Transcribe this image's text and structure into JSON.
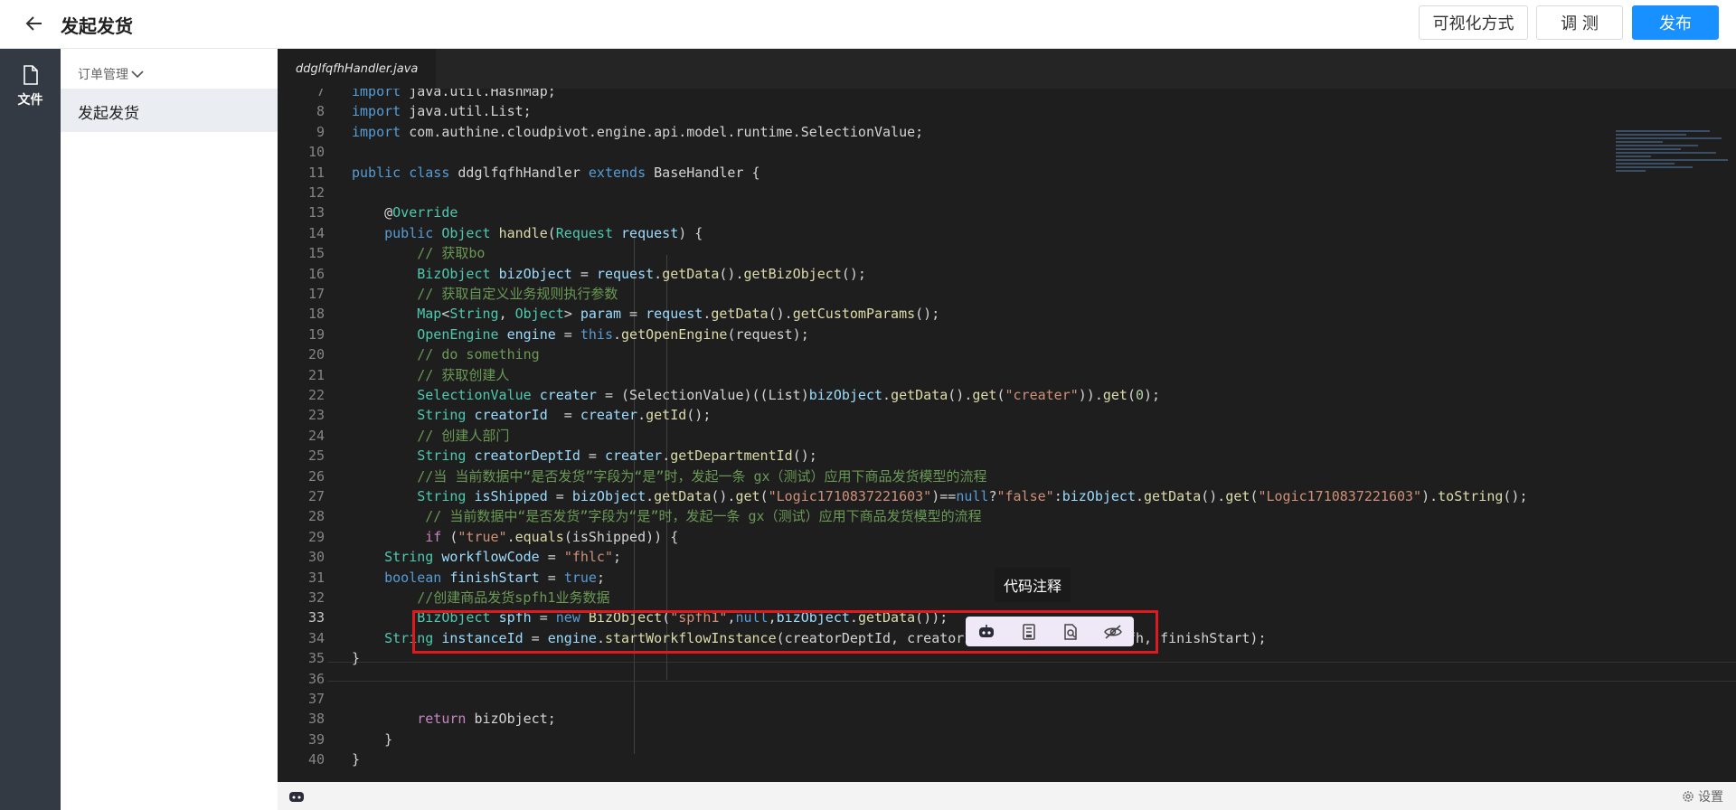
{
  "header": {
    "title": "发起发货",
    "buttons": {
      "visual": "可视化方式",
      "debug": "调 测",
      "publish": "发布"
    }
  },
  "rail": {
    "file_label": "文件"
  },
  "nav": {
    "group": "订单管理",
    "item": "发起发货"
  },
  "editor": {
    "tab": "ddglfqfhHandler.java",
    "tooltip": "代码注释",
    "lines": [
      {
        "n": "7",
        "html": "<span class=\"k\">import</span> java.util.HashMap;"
      },
      {
        "n": "8",
        "html": "<span class=\"k\">import</span> java.util.List;"
      },
      {
        "n": "9",
        "html": "<span class=\"k\">import</span> com.authine.cloudpivot.engine.api.model.runtime.SelectionValue;"
      },
      {
        "n": "10",
        "html": ""
      },
      {
        "n": "11",
        "html": "<span class=\"k\">public class</span> ddglfqfhHandler <span class=\"k\">extends</span> BaseHandler {"
      },
      {
        "n": "12",
        "html": ""
      },
      {
        "n": "13",
        "html": "    @<span class=\"t\">Override</span>"
      },
      {
        "n": "14",
        "html": "    <span class=\"k\">public</span> <span class=\"t\">Object</span> <span class=\"f\">handle</span>(<span class=\"t\">Request</span> <span class=\"v\">request</span>) {"
      },
      {
        "n": "15",
        "html": "        <span class=\"c\">// 获取bo</span>"
      },
      {
        "n": "16",
        "html": "        <span class=\"t\">BizObject</span> <span class=\"v\">bizObject</span> = <span class=\"v\">request</span>.<span class=\"f\">getData</span>().<span class=\"f\">getBizObject</span>();"
      },
      {
        "n": "17",
        "html": "        <span class=\"c\">// 获取自定义业务规则执行参数</span>"
      },
      {
        "n": "18",
        "html": "        <span class=\"t\">Map</span>&lt;<span class=\"t\">String</span>, <span class=\"t\">Object</span>&gt; <span class=\"v\">param</span> = <span class=\"v\">request</span>.<span class=\"f\">getData</span>().<span class=\"f\">getCustomParams</span>();"
      },
      {
        "n": "19",
        "html": "        <span class=\"t\">OpenEngine</span> <span class=\"v\">engine</span> = <span class=\"k\">this</span>.<span class=\"f\">getOpenEngine</span>(request);"
      },
      {
        "n": "20",
        "html": "        <span class=\"c\">// do something</span>"
      },
      {
        "n": "21",
        "html": "        <span class=\"c\">// 获取创建人</span>"
      },
      {
        "n": "22",
        "html": "        <span class=\"t\">SelectionValue</span> <span class=\"v\">creater</span> = (SelectionValue)((List)<span class=\"v\">bizObject</span>.<span class=\"f\">getData</span>().<span class=\"f\">get</span>(<span class=\"s\">\"creater\"</span>)).<span class=\"f\">get</span>(<span class=\"n\">0</span>);"
      },
      {
        "n": "23",
        "html": "        <span class=\"t\">String</span> <span class=\"v\">creatorId</span>  = <span class=\"v\">creater</span>.<span class=\"f\">getId</span>();"
      },
      {
        "n": "24",
        "html": "        <span class=\"c\">// 创建人部门</span>"
      },
      {
        "n": "25",
        "html": "        <span class=\"t\">String</span> <span class=\"v\">creatorDeptId</span> = <span class=\"v\">creater</span>.<span class=\"f\">getDepartmentId</span>();"
      },
      {
        "n": "26",
        "html": "        <span class=\"c\">//当 当前数据中“是否发货”字段为“是”时，发起一条 gx（测试）应用下商品发货模型的流程</span>"
      },
      {
        "n": "27",
        "html": "        <span class=\"t\">String</span> <span class=\"v\">isShipped</span> = <span class=\"v\">bizObject</span>.<span class=\"f\">getData</span>().<span class=\"f\">get</span>(<span class=\"s\">\"Logic1710837221603\"</span>)==<span class=\"k\">null</span>?<span class=\"s\">\"false\"</span>:<span class=\"v\">bizObject</span>.<span class=\"f\">getData</span>().<span class=\"f\">get</span>(<span class=\"s\">\"Logic1710837221603\"</span>).<span class=\"f\">toString</span>();"
      },
      {
        "n": "28",
        "html": "         <span class=\"c\">// 当前数据中“是否发货”字段为“是”时，发起一条 gx（测试）应用下商品发货模型的流程</span>"
      },
      {
        "n": "29",
        "html": "         <span class=\"p\">if</span> (<span class=\"s\">\"true\"</span>.<span class=\"f\">equals</span>(isShipped)) {"
      },
      {
        "n": "30",
        "html": "    <span class=\"t\">String</span> <span class=\"v\">workflowCode</span> = <span class=\"s\">\"fhlc\"</span>;"
      },
      {
        "n": "31",
        "html": "    <span class=\"k\">boolean</span> <span class=\"v\">finishStart</span> = <span class=\"k\">true</span>;"
      },
      {
        "n": "32",
        "html": "        <span class=\"c\">//创建商品发货spfh1业务数据</span>"
      },
      {
        "n": "33",
        "html": "        <span class=\"t\">BizObject</span> <span class=\"v\">spfh</span> = <span class=\"k\">new</span> <span class=\"f\">BizObject</span>(<span class=\"s\">\"spfh1\"</span>,<span class=\"k\">null</span>,<span class=\"v\">bizObject</span>.<span class=\"f\">getData</span>());"
      },
      {
        "n": "34",
        "html": "    <span class=\"t\">String</span> <span class=\"v\">instanceId</span> = <span class=\"v\">engine</span>.<span class=\"f\">startWorkflowInstance</span>(creatorDeptId, creatorId, workflowCode, spfh, finishStart);"
      },
      {
        "n": "35",
        "html": "}"
      },
      {
        "n": "36",
        "html": ""
      },
      {
        "n": "37",
        "html": ""
      },
      {
        "n": "38",
        "html": "        <span class=\"p\">return</span> bizObject;"
      },
      {
        "n": "39",
        "html": "    }"
      },
      {
        "n": "40",
        "html": "}"
      }
    ]
  },
  "status": {
    "settings": "设置"
  },
  "colors": {
    "accent": "#1890ff",
    "selection_border": "#e0191f"
  }
}
